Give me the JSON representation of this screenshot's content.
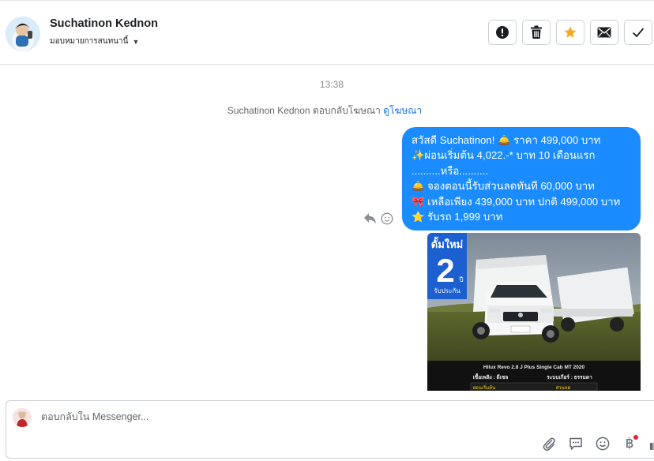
{
  "header": {
    "contact_name": "Suchatinon Kednon",
    "assign_label": "มอบหมายการสนทนานี้",
    "actions": [
      {
        "name": "mark-spam",
        "icon": "exclamation-circle-icon"
      },
      {
        "name": "delete",
        "icon": "trash-icon"
      },
      {
        "name": "star",
        "icon": "star-icon",
        "color": "#f5a623"
      },
      {
        "name": "mark-unread",
        "icon": "envelope-icon"
      },
      {
        "name": "mark-done",
        "icon": "checkmark-icon"
      }
    ]
  },
  "conversation": {
    "timestamp": "13:38",
    "reply_note": {
      "text": "Suchatinon Kednon ตอบกลับโฆษณา",
      "link": "ดูโฆษณา"
    },
    "message": {
      "lines": [
        {
          "text": "สวัสดี Suchatinon! 🛎️  ราคา 499,000 บาท"
        },
        {
          "text": "✨ผ่อนเริ่มต้น 4,022.-* บาท 10 เดือนแรก"
        },
        {
          "text": "..........หรือ.........."
        },
        {
          "text": "🛎️ จองตอนนี้รับส่วนลดทันที 60,000 บาท"
        },
        {
          "text": "🎀 เหลือเพียง 439,000 บาท ปกติ 499,000 บาท"
        },
        {
          "text": "⭐ รับรถ 1,999 บาท"
        }
      ],
      "bubble_color": "#1b8cff"
    },
    "ad_image": {
      "badge_top": "ดั้มใหม่",
      "badge_number": "2",
      "badge_unit": "ปี",
      "badge_bottom": "รับประกัน",
      "model": "Hilux Revo 2.8 J Plus Single Cab MT 2020",
      "spec_fuel": "เชื้อเพลิง : ดีเซล",
      "spec_gear": "ระบบเกียร์ : ธรรมดา",
      "footer_left": "ผ่อนเริ่มต้น",
      "footer_right": "ส่วนลด"
    }
  },
  "composer": {
    "placeholder": "ตอบกลับใน Messenger...",
    "tools": [
      "paperclip-icon",
      "chat-bubble-icon",
      "smiley-icon",
      "baht-icon",
      "thumbs-up-icon"
    ]
  },
  "colors": {
    "accent": "#1b74e4",
    "bubble": "#1b8cff",
    "star": "#f5a623",
    "notification_dot": "#e41e3f"
  }
}
